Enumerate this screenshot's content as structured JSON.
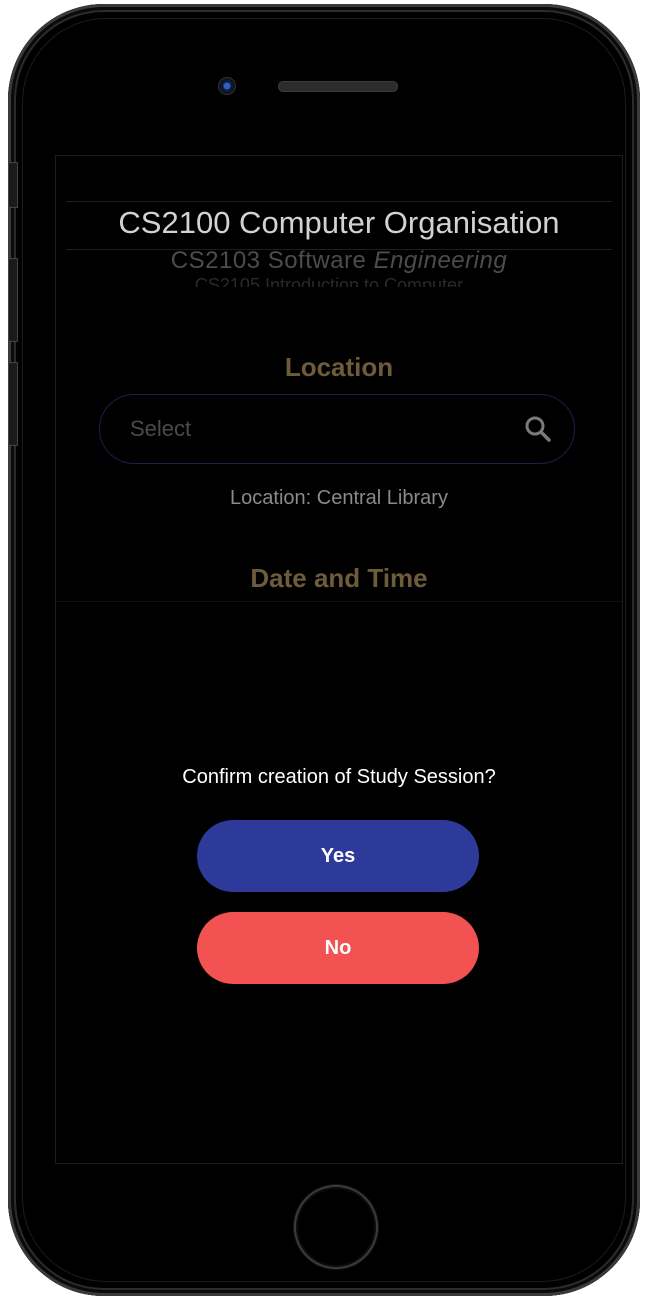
{
  "picker": {
    "selected": "CS2100 Computer Organisation",
    "next_prefix": "CS2103 Software ",
    "next_suffix": "Engineering",
    "third": "CS2105 Introduction to Computer ..."
  },
  "location": {
    "title": "Location",
    "search_placeholder": "Select",
    "current": "Location: Central Library"
  },
  "date_time": {
    "title": "Date and Time"
  },
  "dialog": {
    "message": "Confirm creation of Study Session?",
    "yes_label": "Yes",
    "no_label": "No"
  },
  "colors": {
    "accent_gold": "#6e5b3a",
    "yes_button": "#2e3a9a",
    "no_button": "#f25252"
  },
  "icons": [
    "search-icon"
  ]
}
